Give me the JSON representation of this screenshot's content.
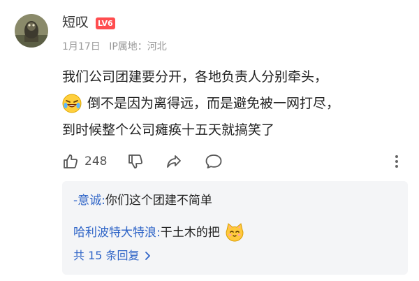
{
  "comment": {
    "username": "短叹",
    "level_badge": "LV6",
    "date": "1月17日",
    "ip_location": "IP属地：河北",
    "body_lines": [
      "我们公司团建要分开，各地负责人分别牵头，",
      "倒不是因为离得远，而是避免被一网打尽，",
      "到时候整个公司瘫痪十五天就搞笑了"
    ],
    "like_count": "248"
  },
  "replies": {
    "items": [
      {
        "author": "-意诚:",
        "text": " 你们这个团建不简单"
      },
      {
        "author": "哈利波特大特浪:",
        "text": " 干土木的把"
      }
    ],
    "more_label": "共 15 条回复"
  },
  "colors": {
    "link_blue": "#2e64c7",
    "badge_red": "#ff4d4f",
    "reply_bg": "#f4f5f7",
    "meta_gray": "#999999"
  }
}
